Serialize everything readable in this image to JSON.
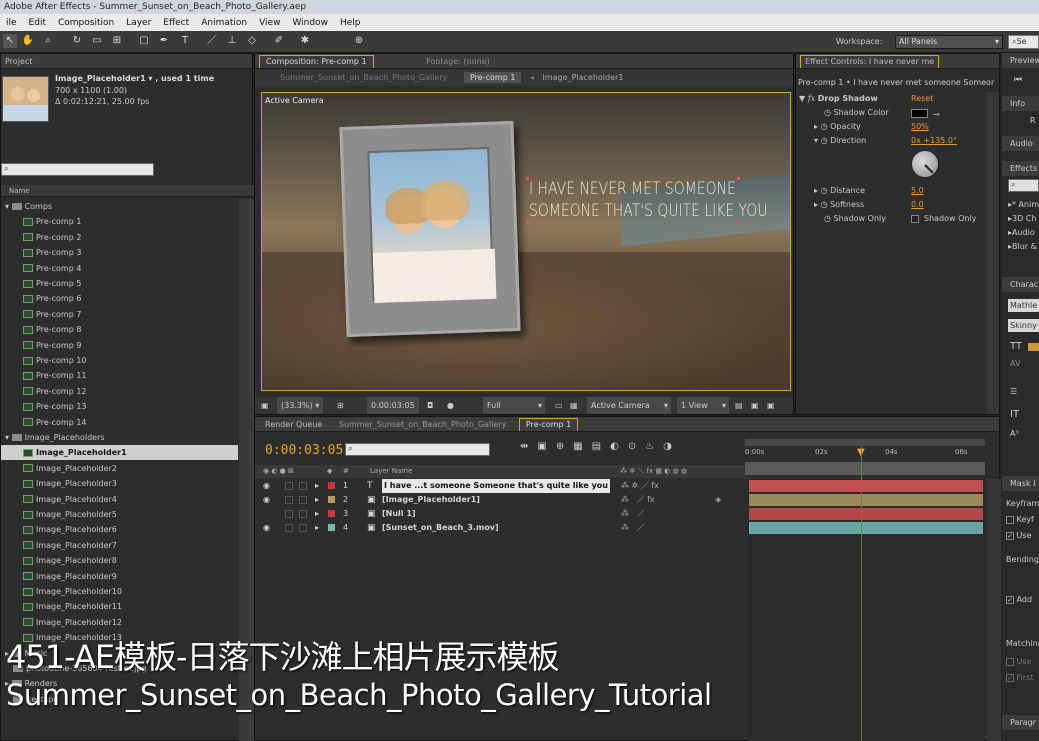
{
  "window": {
    "title": "Adobe After Effects - Summer_Sunset_on_Beach_Photo_Gallery.aep"
  },
  "menu": [
    "ile",
    "Edit",
    "Composition",
    "Layer",
    "Effect",
    "Animation",
    "View",
    "Window",
    "Help"
  ],
  "toolbar": {
    "workspace_label": "Workspace:",
    "workspace_value": "All Panels",
    "search_placeholder": "Se"
  },
  "project": {
    "tab": "Project",
    "item_name": "Image_Placeholder1 ▾ , used 1 time",
    "item_dims": "700 x 1100 (1.00)",
    "item_duration": "Δ 0:02:12:21, 25.00 fps",
    "col_name": "Name",
    "folders": {
      "comps": "Comps",
      "image_placeholders": "Image_Placeholders",
      "music": "Music",
      "music_file": "photodune-365604-rest-m.jpg",
      "renders": "Renders",
      "renders_file": "Rest.jpg"
    },
    "comps": [
      "Pre-comp 1",
      "Pre-comp 2",
      "Pre-comp 3",
      "Pre-comp 4",
      "Pre-comp 5",
      "Pre-comp 6",
      "Pre-comp 7",
      "Pre-comp 8",
      "Pre-comp 9",
      "Pre-comp 10",
      "Pre-comp 11",
      "Pre-comp 12",
      "Pre-comp 13",
      "Pre-comp 14"
    ],
    "placeholders": [
      "Image_Placeholder1",
      "Image_Placeholder2",
      "Image_Placeholder3",
      "Image_Placeholder4",
      "Image_Placeholder5",
      "Image_Placeholder6",
      "Image_Placeholder7",
      "Image_Placeholder8",
      "Image_Placeholder9",
      "Image_Placeholder10",
      "Image_Placeholder11",
      "Image_Placeholder12",
      "Image_Placeholder13"
    ]
  },
  "composition": {
    "tab": "Composition: Pre-comp 1",
    "footage_tab": "Footage: (none)",
    "breadcrumb": [
      "Summer_Sunset_on_Beach_Photo_Gallery",
      "Pre-comp 1",
      "Image_Placeholder1"
    ],
    "camera_label": "Active Camera",
    "overlay_text_line1": "I HAVE NEVER MET SOMEONE",
    "overlay_text_line2": "SOMEONE THAT'S QUITE LIKE YOU",
    "zoom": "(33.3%)",
    "timecode": "0:00:03:05",
    "resolution": "Full",
    "camera": "Active Camera",
    "view": "1 View"
  },
  "effect_controls": {
    "tab": "Effect Controls: I have never me",
    "header": "Pre-comp 1 • I have never met someone Someor",
    "effect_name": "Drop Shadow",
    "reset": "Reset",
    "props": [
      {
        "name": "Shadow Color",
        "value": ""
      },
      {
        "name": "Opacity",
        "value": "50%"
      },
      {
        "name": "Direction",
        "value": "0x +135.0°"
      },
      {
        "name": "Distance",
        "value": "5.0"
      },
      {
        "name": "Softness",
        "value": "0.0"
      },
      {
        "name": "Shadow Only",
        "value": "Shadow Only"
      }
    ]
  },
  "right_panels": {
    "preview": "Preview",
    "info": "Info",
    "audio": "Audio",
    "effects": "Effects",
    "effects_items": [
      "* Anim",
      "3D Ch",
      "Audio",
      "Blur &"
    ],
    "character": "Charac",
    "font1": "Mathle",
    "font2": "Skinny",
    "mask": "Mask I",
    "keyframe": "Keyfram",
    "keyf": "Keyf",
    "use": "Use",
    "bending": "Bending",
    "add": "Add",
    "matching": "Matching",
    "use2": "Use",
    "first": "First",
    "paragraph": "Paragr"
  },
  "timeline": {
    "tabs": [
      "Render Queue",
      "Summer_Sunset_on_Beach_Photo_Gallery",
      "Pre-comp 1"
    ],
    "timecode": "0:00:03:05",
    "col_layer_name": "Layer Name",
    "ruler": [
      "0:00s",
      "02s",
      "04s",
      "06s"
    ],
    "layers": [
      {
        "num": "1",
        "name": "I have ...t someone Someone that's quite like you",
        "color": "#c83a3a",
        "bar": "#c25050"
      },
      {
        "num": "2",
        "name": "[Image_Placeholder1]",
        "color": "#b89a6a",
        "bar": "#9a8a60"
      },
      {
        "num": "3",
        "name": "[Null 1]",
        "color": "#c83a3a",
        "bar": "#b34848"
      },
      {
        "num": "4",
        "name": "[Sunset_on_Beach_3.mov]",
        "color": "#7fb5b5",
        "bar": "#6aa6a6"
      }
    ]
  },
  "caption": {
    "line1": "451-AE模板-日落下沙滩上相片展示模板",
    "line2": "Summer_Sunset_on_Beach_Photo_Gallery_Tutorial"
  },
  "colors": {
    "accent_orange": "#e89a2c",
    "panel_bg": "#2d2d2d",
    "highlight_border": "#d6a32e"
  }
}
